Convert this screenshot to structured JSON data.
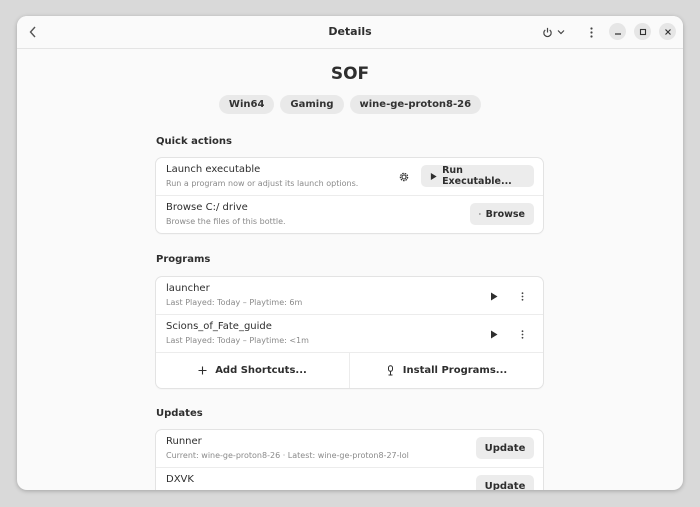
{
  "header": {
    "title": "Details"
  },
  "bottle": {
    "name": "SOF",
    "tags": [
      "Win64",
      "Gaming",
      "wine-ge-proton8-26"
    ]
  },
  "quick_actions": {
    "title": "Quick actions",
    "launch": {
      "title": "Launch executable",
      "subtitle": "Run a program now or adjust its launch options.",
      "button": "Run Executable..."
    },
    "browse": {
      "title": "Browse C:/ drive",
      "subtitle": "Browse the files of this bottle.",
      "button": "Browse"
    }
  },
  "programs": {
    "title": "Programs",
    "items": [
      {
        "name": "launcher",
        "meta": "Last Played: Today – Playtime: 6m"
      },
      {
        "name": "Scions_of_Fate_guide",
        "meta": "Last Played: Today – Playtime: <1m"
      }
    ],
    "add_shortcuts": "Add Shortcuts...",
    "install_programs": "Install Programs..."
  },
  "updates": {
    "title": "Updates",
    "items": [
      {
        "name": "Runner",
        "meta": "Current: wine-ge-proton8-26 · Latest: wine-ge-proton8-27-lol",
        "button": "Update"
      },
      {
        "name": "DXVK",
        "meta": "",
        "button": "Update"
      }
    ]
  },
  "colors": {
    "background": "#fafafa",
    "card": "#ffffff",
    "button": "#ececec",
    "text": "#2e2e2e",
    "muted": "#8a8a8a"
  }
}
